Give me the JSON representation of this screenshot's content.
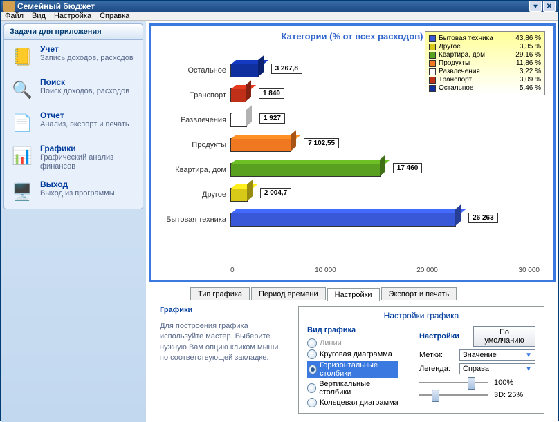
{
  "window": {
    "title": "Семейный бюджет"
  },
  "menu": {
    "file": "Файл",
    "view": "Вид",
    "settings": "Настройка",
    "help": "Справка"
  },
  "sidebar": {
    "header": "Задачи для приложения",
    "items": [
      {
        "title": "Учет",
        "desc": "Запись доходов, расходов"
      },
      {
        "title": "Поиск",
        "desc": "Поиск доходов, расходов"
      },
      {
        "title": "Отчет",
        "desc": "Анализ, экспорт и печать"
      },
      {
        "title": "Графики",
        "desc": "Графический анализ финансов"
      },
      {
        "title": "Выход",
        "desc": "Выход из программы"
      }
    ]
  },
  "chart_data": {
    "type": "bar",
    "orientation": "horizontal",
    "title": "Категории (% от всех расходов)",
    "xlabel": "",
    "ylabel": "",
    "xlim": [
      0,
      36000
    ],
    "ticks": [
      "0",
      "10 000",
      "20 000",
      "30 000"
    ],
    "categories": [
      "Остальное",
      "Транспорт",
      "Развлечения",
      "Продукты",
      "Квартира, дом",
      "Другое",
      "Бытовая техника"
    ],
    "values": [
      3267.8,
      1849,
      1927,
      7102.55,
      17460,
      2004.7,
      26263
    ],
    "value_labels": [
      "3 267,8",
      "1 849",
      "1 927",
      "7 102,55",
      "17 460",
      "2 004,7",
      "26 263"
    ],
    "colors": [
      "#1030a0",
      "#c03018",
      "#ffffff",
      "#f07820",
      "#5aa020",
      "#d8c818",
      "#3858d8"
    ],
    "legend_position": "top-right",
    "legend": [
      {
        "label": "Бытовая техника",
        "pct": "43,86 %",
        "color": "#3858d8"
      },
      {
        "label": "Другое",
        "pct": "3,35 %",
        "color": "#d8c818"
      },
      {
        "label": "Квартира, дом",
        "pct": "29,16 %",
        "color": "#5aa020"
      },
      {
        "label": "Продукты",
        "pct": "11,86 %",
        "color": "#f07820"
      },
      {
        "label": "Развлечения",
        "pct": "3,22 %",
        "color": "#ffffff"
      },
      {
        "label": "Транспорт",
        "pct": "3,09 %",
        "color": "#c03018"
      },
      {
        "label": "Остальное",
        "pct": "5,46 %",
        "color": "#1030a0"
      }
    ]
  },
  "tabs": {
    "list": [
      "Тип графика",
      "Период времени",
      "Настройки",
      "Экспорт и печать"
    ],
    "active": 2
  },
  "help": {
    "title": "Графики",
    "text": "Для построения графика используйте мастер. Выберите нужную Вам опцию кликом мыши по соответствующей закладке."
  },
  "settings": {
    "panel_title": "Настройки графика",
    "chart_type_title": "Вид графика",
    "options_title": "Настройки",
    "default_btn": "По умолчанию",
    "radios": [
      {
        "label": "Линии",
        "enabled": false,
        "selected": false
      },
      {
        "label": "Круговая диаграмма",
        "enabled": true,
        "selected": false
      },
      {
        "label": "Горизонтальные столбики",
        "enabled": true,
        "selected": true
      },
      {
        "label": "Вертикальные столбики",
        "enabled": true,
        "selected": false
      },
      {
        "label": "Кольцевая диаграмма",
        "enabled": true,
        "selected": false
      }
    ],
    "labels_field": "Метки:",
    "labels_value": "Значение",
    "legend_field": "Легенда:",
    "legend_value": "Справа",
    "slider1": "100%",
    "slider2": "3D: 25%"
  }
}
